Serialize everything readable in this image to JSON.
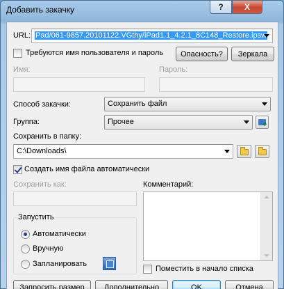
{
  "window": {
    "title": "Добавить закачку",
    "help_glyph": "?",
    "close_glyph": "X"
  },
  "url": {
    "label": "URL:",
    "value": "Pad/061-9857.20101122.VGthy/iPad1,1_4.2.1_8C148_Restore.ipsw"
  },
  "auth": {
    "checkbox_label": "Требуются имя пользователя и пароль",
    "checked": false,
    "danger_button": "Опасность?",
    "mirrors_button": "Зеркала",
    "name_label": "Имя:",
    "password_label": "Пароль:",
    "name_value": "",
    "password_value": ""
  },
  "method": {
    "label": "Способ закачки:",
    "value": "Сохранить файл"
  },
  "group": {
    "label": "Группа:",
    "value": "Прочее"
  },
  "folder": {
    "label": "Сохранить в папку:",
    "value": "C:\\Downloads\\"
  },
  "auto_name": {
    "label": "Создать имя файла автоматически",
    "checked": true
  },
  "save_as": {
    "label": "Сохранить как:",
    "value": ""
  },
  "comment": {
    "label": "Комментарий:",
    "value": ""
  },
  "start": {
    "title": "Запустить",
    "options": [
      {
        "label": "Автоматически",
        "checked": true
      },
      {
        "label": "Вручную",
        "checked": false
      },
      {
        "label": "Запланировать",
        "checked": false
      }
    ]
  },
  "top_of_list": {
    "label": "Поместить в начало списка",
    "checked": false
  },
  "buttons": {
    "request_size": "Запросить размер",
    "more": "Дополнительно",
    "ok": "OK",
    "cancel": "Отмена"
  }
}
